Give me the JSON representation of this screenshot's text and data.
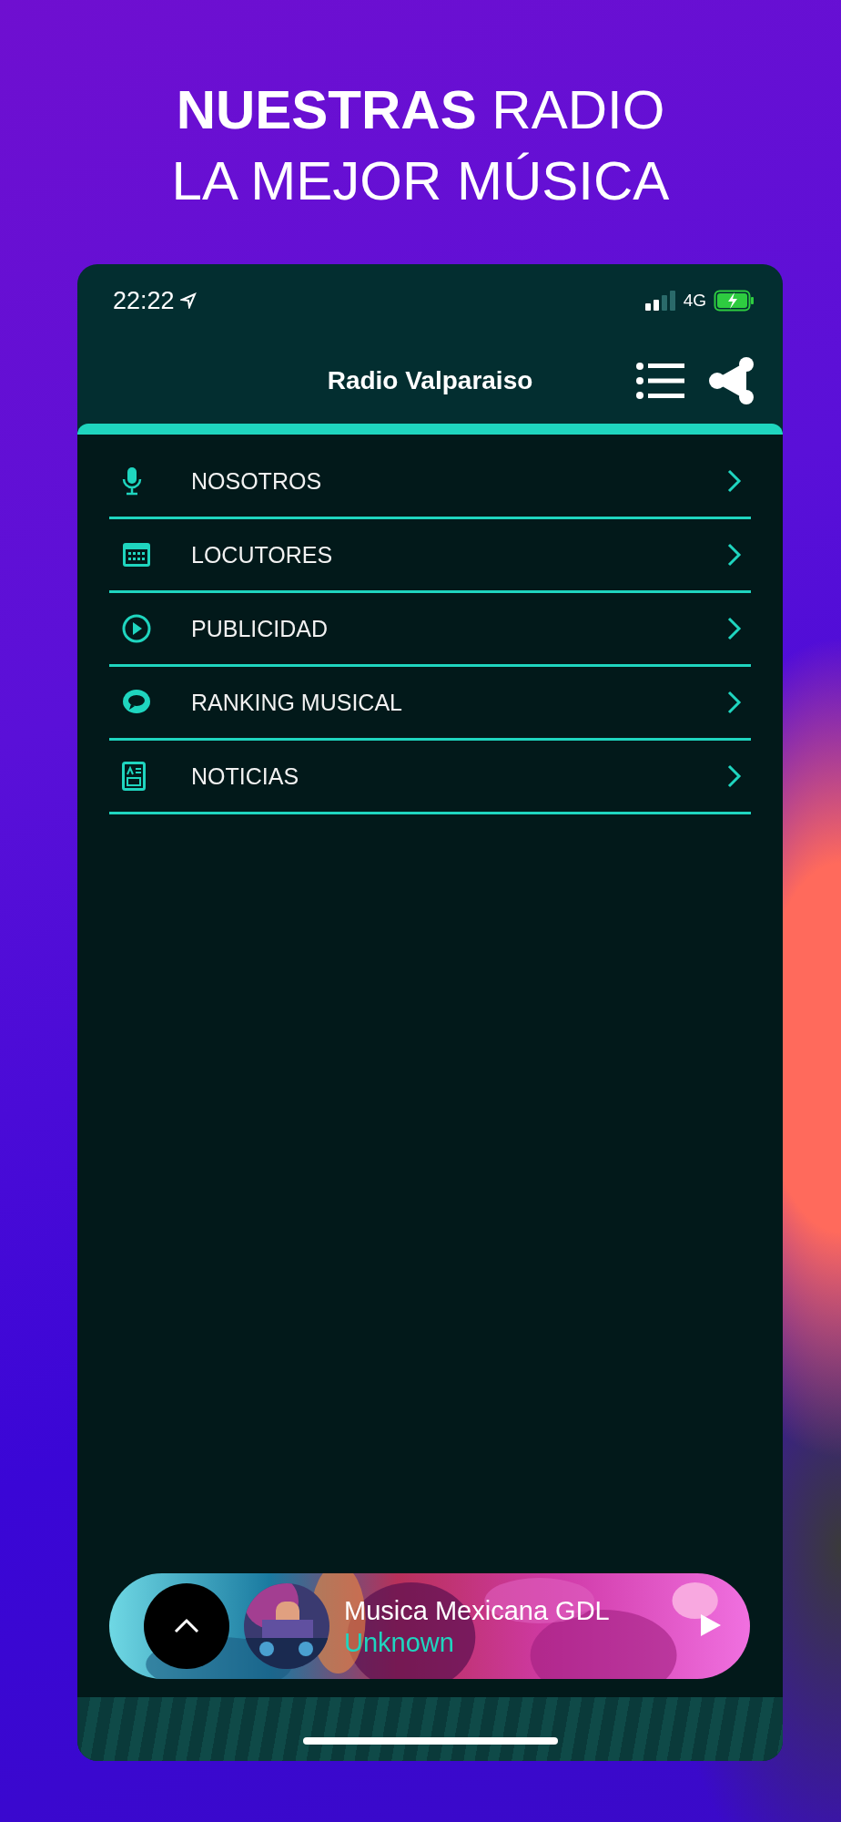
{
  "headline": {
    "line_1": "**NUESTRAS** RADIO",
    "line_2": "LA MEJOR MÚSICA"
  },
  "status_bar": {
    "time": "22:22",
    "network": "4G"
  },
  "nav_bar": {
    "title": "Radio Valparaiso"
  },
  "menu": [
    {
      "label": "NOSOTROS"
    },
    {
      "label": "LOCUTORES"
    },
    {
      "label": "PUBLICIDAD"
    },
    {
      "label": "RANKING MUSICAL"
    },
    {
      "label": "NOTICIAS"
    }
  ],
  "player": {
    "title": "Musica Mexicana GDL",
    "subtitle": "Unknown"
  }
}
